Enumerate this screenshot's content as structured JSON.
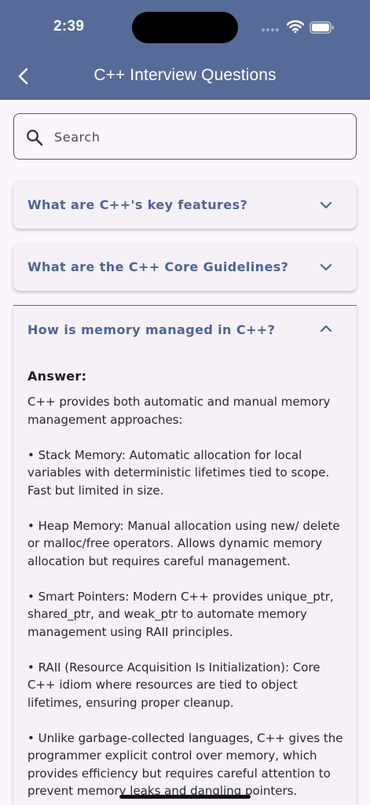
{
  "status_bar": {
    "time": "2:39",
    "icons": [
      "cellular-signal-icon",
      "wifi-icon",
      "battery-icon"
    ]
  },
  "app_bar": {
    "title": "C++ Interview Questions",
    "back_icon": "chevron-left-icon",
    "background_color": "#566b97"
  },
  "search": {
    "placeholder": "Search",
    "value": "",
    "icon": "search-icon"
  },
  "questions": [
    {
      "question": "What are C++'s key features?",
      "expanded": false
    },
    {
      "question": "What are the C++ Core Guidelines?",
      "expanded": false
    },
    {
      "question": "How is memory managed in C++?",
      "expanded": true,
      "answer_label": "Answer:",
      "answer": "C++ provides both automatic and manual memory management approaches:\n\n• Stack Memory: Automatic allocation for local variables with deterministic lifetimes tied to scope. Fast but limited in size.\n\n• Heap Memory: Manual allocation using new/ delete or malloc/free operators. Allows dynamic memory allocation but requires careful management.\n\n• Smart Pointers: Modern C++ provides unique_ptr, shared_ptr, and weak_ptr to automate memory management using RAII principles.\n\n• RAII (Resource Acquisition Is Initialization): Core C++ idiom where resources are tied to object lifetimes, ensuring proper cleanup.\n\n• Unlike garbage-collected languages, C++ gives the programmer explicit control over memory, which provides efficiency but requires careful attention to prevent memory leaks and dangling pointers."
    }
  ],
  "colors": {
    "accent": "#4e6694",
    "background": "#fbf6fb",
    "card": "#f6f0f7"
  }
}
